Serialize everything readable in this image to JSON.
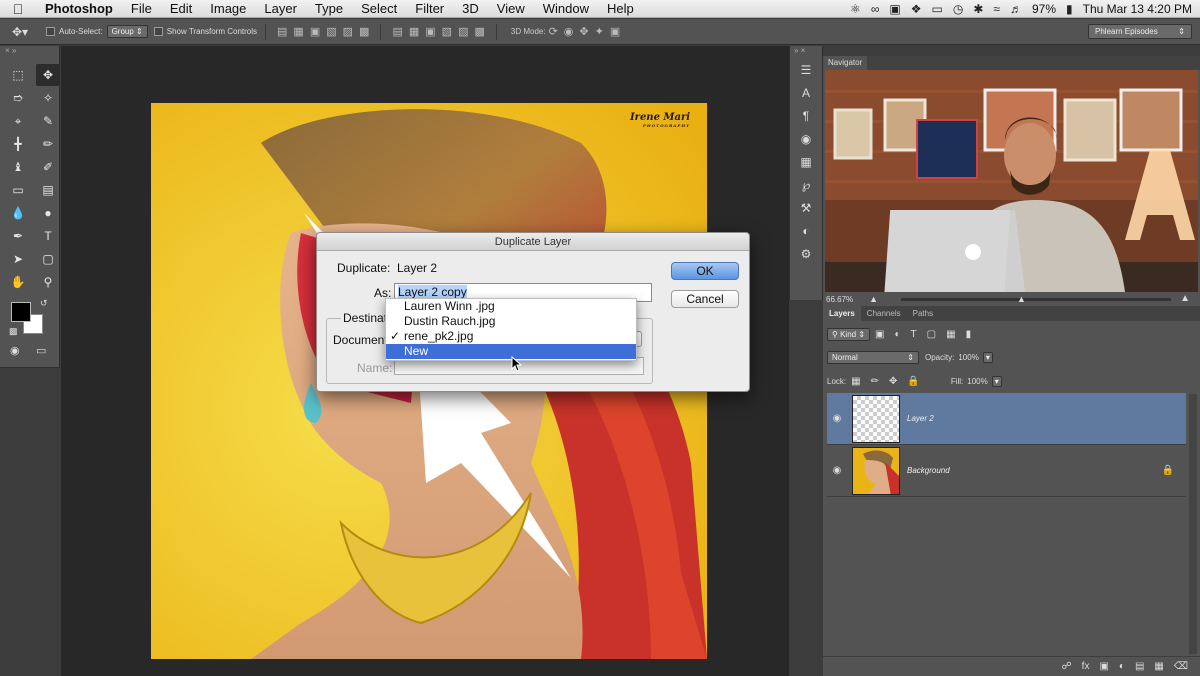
{
  "menubar": {
    "app_name": "Photoshop",
    "items": [
      "File",
      "Edit",
      "Image",
      "Layer",
      "Type",
      "Select",
      "Filter",
      "3D",
      "View",
      "Window",
      "Help"
    ],
    "battery": "97%",
    "clock": "Thu Mar 13  4:20 PM"
  },
  "options_bar": {
    "auto_select_label": "Auto-Select:",
    "auto_select_value": "Group",
    "show_transform_label": "Show Transform Controls",
    "mode_label": "3D Mode:",
    "workspace": "Phlearn Episodes"
  },
  "canvas": {
    "watermark_line1": "Irene Mari",
    "watermark_line2": "PHOTOGRAPHY"
  },
  "dialog": {
    "title": "Duplicate Layer",
    "duplicate_label": "Duplicate:",
    "duplicate_value": "Layer 2",
    "as_label": "As:",
    "as_value": "Layer 2 copy",
    "destination_label": "Destinat",
    "document_label": "Document",
    "name_label": "Name:",
    "ok": "OK",
    "cancel": "Cancel"
  },
  "document_popup": {
    "options": [
      {
        "label": "Lauren Winn .jpg",
        "check": ""
      },
      {
        "label": "Dustin Rauch.jpg",
        "check": ""
      },
      {
        "label": "rene_pk2.jpg",
        "check": "✓"
      },
      {
        "label": "New",
        "check": ""
      }
    ],
    "highlighted": "New"
  },
  "navigator": {
    "tab": "Navigator",
    "zoom": "66.67%"
  },
  "layers_panel": {
    "tabs": [
      "Layers",
      "Channels",
      "Paths"
    ],
    "kind": "Kind",
    "blend_mode": "Normal",
    "opacity_label": "Opacity:",
    "opacity": "100%",
    "lock_label": "Lock:",
    "fill_label": "Fill:",
    "fill": "100%",
    "layers": [
      {
        "name": "Layer 2",
        "selected": true
      },
      {
        "name": "Background",
        "selected": false
      }
    ]
  },
  "colors": {
    "accent": "#3f6ed8",
    "panel": "#535353",
    "canvas_bg": "#282828",
    "selection": "#5f7a9e"
  },
  "icons": {
    "menubar_left": "apple-icon",
    "menubar_right": [
      "evernote-icon",
      "creative-cloud-icon",
      "screen-record-icon",
      "dropbox-icon",
      "airplay-icon",
      "time-machine-icon",
      "bluetooth-icon",
      "wifi-icon",
      "volume-icon",
      "battery-icon"
    ]
  }
}
